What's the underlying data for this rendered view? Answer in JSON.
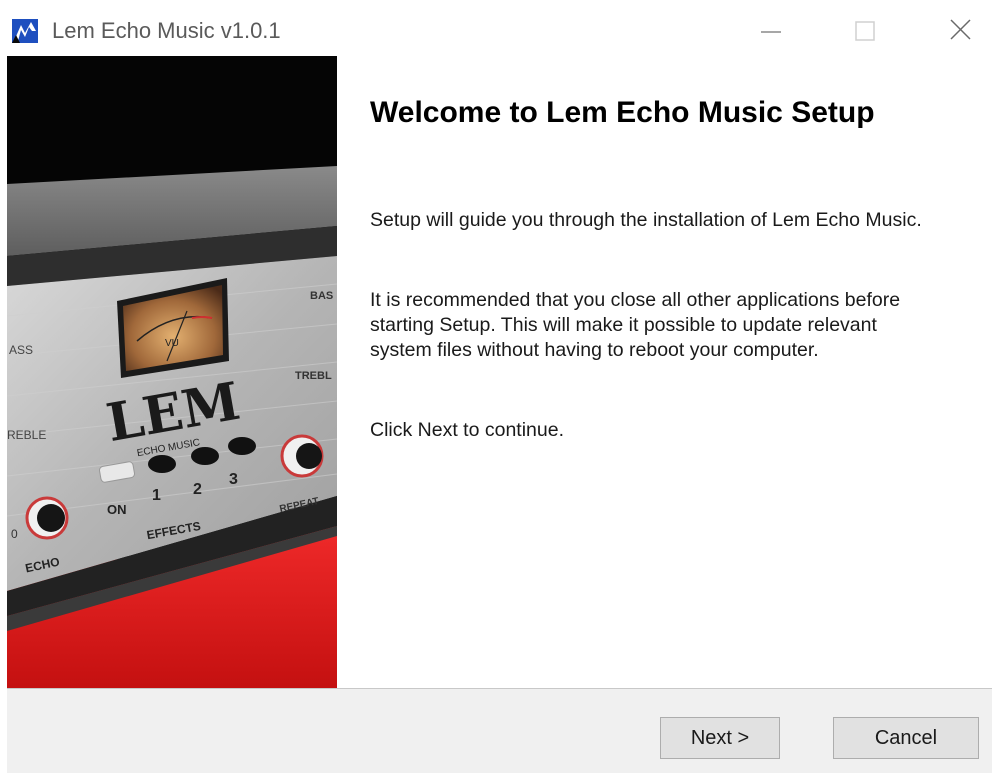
{
  "window": {
    "title": "Lem Echo Music v1.0.1",
    "icon": "app-logo-icon",
    "controls": [
      "minimize-icon",
      "maximize-icon",
      "close-icon"
    ]
  },
  "hero_panel": {
    "labels": {
      "vu": "VU",
      "brand": "LEM",
      "sub_brand": "ECHO MUSIC",
      "bass_right": "BAS",
      "treble_right": "TREBL",
      "bass_left": "ASS",
      "treble_left": "REBLE",
      "on": "ON",
      "effect_1": "1",
      "effect_2": "2",
      "effect_3": "3",
      "effects": "EFFECTS",
      "echo": "ECHO",
      "repeat": "REPEAT",
      "zero": "0"
    }
  },
  "content": {
    "heading": "Welcome to Lem Echo Music Setup",
    "paragraph_1": "Setup will guide you through the installation of Lem Echo Music.",
    "paragraph_2": "It is recommended that you close all other applications before starting Setup. This will make it possible to update relevant system files without having to reboot your computer.",
    "paragraph_3": "Click Next to continue."
  },
  "footer": {
    "next_label": "Next >",
    "cancel_label": "Cancel"
  },
  "colors": {
    "accent_red": "#e02020",
    "panel_silver": "#bdbdbd",
    "window_bg": "#ffffff",
    "footer_bg": "#f0f0f0"
  }
}
